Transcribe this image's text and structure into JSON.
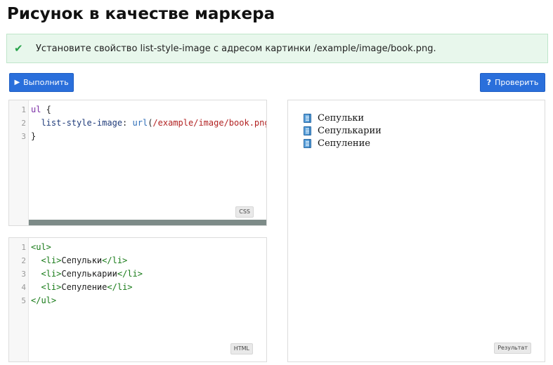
{
  "page": {
    "title": "Рисунок в качестве маркера"
  },
  "task": {
    "icon": "check-icon",
    "text": "Установите свойство list-style-image с адресом картинки /example/image/book.png."
  },
  "toolbar": {
    "run_label": "Выполнить",
    "run_icon": "play-icon",
    "check_label": "Проверить",
    "check_icon": "question-icon"
  },
  "css_editor": {
    "badge": "CSS",
    "line_numbers": [
      "1",
      "2",
      "3"
    ],
    "lines": {
      "l1_selector": "ul",
      "l1_brace": " {",
      "l2_indent": "  ",
      "l2_prop": "list-style-image",
      "l2_colon": ": ",
      "l2_fn": "url",
      "l2_open": "(",
      "l2_str": "/example/image/book.png",
      "l2_close": ");",
      "l3": "}"
    }
  },
  "html_editor": {
    "badge": "HTML",
    "line_numbers": [
      "1",
      "2",
      "3",
      "4",
      "5"
    ],
    "lines": {
      "l1": "<ul>",
      "l2_open": "<li>",
      "l2_text": "Сепульки",
      "l2_close": "</li>",
      "l3_open": "<li>",
      "l3_text": "Сепулькарии",
      "l3_close": "</li>",
      "l4_open": "<li>",
      "l4_text": "Сепуление",
      "l4_close": "</li>",
      "l5": "</ul>"
    }
  },
  "result": {
    "badge": "Результат",
    "marker_icon": "book-icon",
    "items": [
      "Сепульки",
      "Сепулькарии",
      "Сепуление"
    ]
  }
}
